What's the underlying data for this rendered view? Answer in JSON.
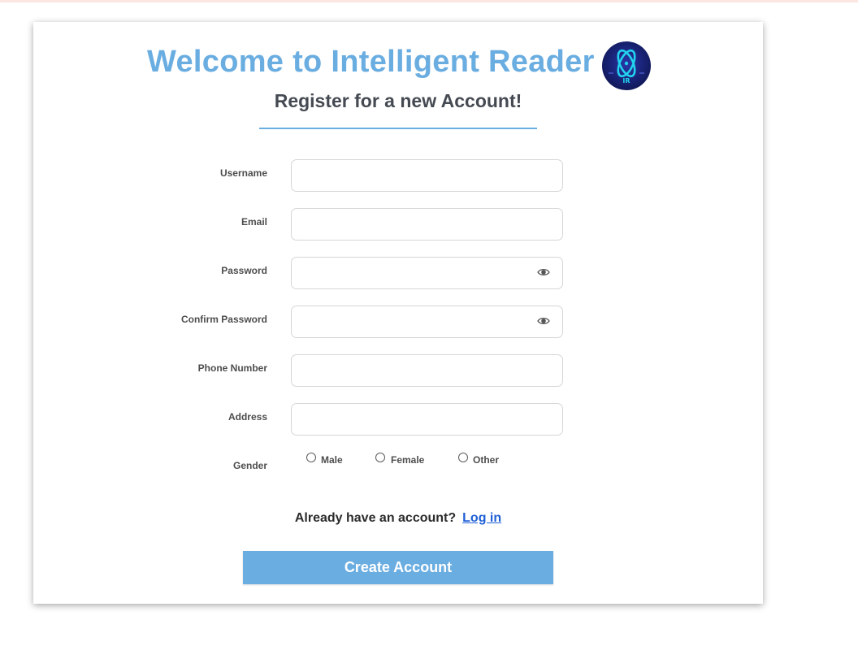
{
  "header": {
    "title": "Welcome to Intelligent Reader",
    "subtitle": "Register for a new Account!",
    "logo_text": "IR"
  },
  "form": {
    "username_label": "Username",
    "email_label": "Email",
    "password_label": "Password",
    "confirm_password_label": "Confirm Password",
    "phone_label": "Phone Number",
    "address_label": "Address",
    "gender_label": "Gender",
    "username_value": "",
    "email_value": "",
    "password_value": "",
    "confirm_password_value": "",
    "phone_value": "",
    "address_value": "",
    "gender_options": [
      "Male",
      "Female",
      "Other"
    ],
    "password_toggle_icon": "eye-icon"
  },
  "footer": {
    "already_text": "Already have an account?",
    "login_link": "Log in",
    "create_button": "Create Account"
  },
  "colors": {
    "accent": "#6aade1",
    "link": "#1f5fd6",
    "subtitle": "#454a52"
  }
}
